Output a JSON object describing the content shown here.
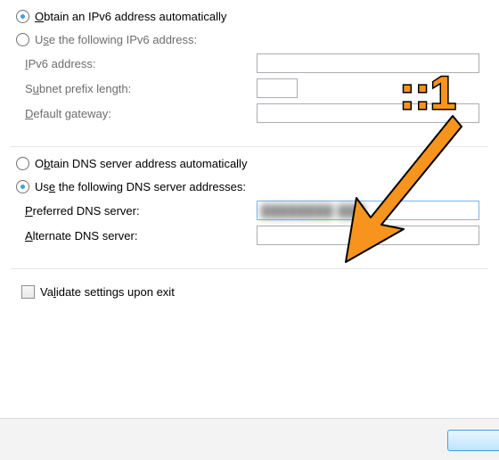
{
  "ipv6": {
    "obtain_auto_label": "Obtain an IPv6 address automatically",
    "use_following_label": "Use the following IPv6 address:",
    "address_label": "IPv6 address:",
    "prefix_label": "Subnet prefix length:",
    "gateway_label": "Default gateway:",
    "address_value": "",
    "prefix_value": "",
    "gateway_value": "",
    "selected": "auto"
  },
  "dns": {
    "obtain_auto_label": "Obtain DNS server address automatically",
    "use_following_label": "Use the following DNS server addresses:",
    "preferred_label": "Preferred DNS server:",
    "alternate_label": "Alternate DNS server:",
    "preferred_value": "████████ ███",
    "alternate_value": "",
    "selected": "manual"
  },
  "validate_label": "Validate settings upon exit",
  "validate_checked": false,
  "annotation_text": "::1"
}
